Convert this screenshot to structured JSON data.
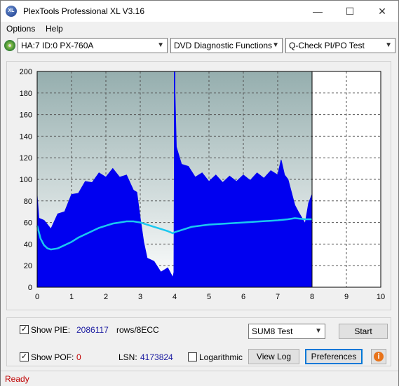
{
  "window": {
    "title": "PlexTools Professional XL V3.16",
    "icon_text": "XL",
    "controls": {
      "minimize": "—",
      "maximize": "☐",
      "close": "✕"
    }
  },
  "menu": {
    "items": [
      "Options",
      "Help"
    ]
  },
  "toolbar": {
    "drive": "HA:7 ID:0  PX-760A",
    "function": "DVD Diagnostic Functions",
    "test": "Q-Check PI/PO Test"
  },
  "chart_data": {
    "type": "area",
    "xlim": [
      0,
      10
    ],
    "ylim": [
      0,
      200
    ],
    "x_ticks": [
      "0",
      "1",
      "2",
      "3",
      "4",
      "5",
      "6",
      "7",
      "8",
      "9",
      "10"
    ],
    "y_ticks": [
      "0",
      "20",
      "40",
      "60",
      "80",
      "100",
      "120",
      "140",
      "160",
      "180",
      "200"
    ],
    "grid": true,
    "colors": {
      "plot_bg": "#95aeae",
      "pie": "#0000f0",
      "sum8": "#1ac8f0",
      "frame": "#000000"
    },
    "series": [
      {
        "name": "",
        "role": "pie_envelope",
        "x": [
          0,
          0.05,
          0.2,
          0.4,
          0.6,
          0.8,
          1.0,
          1.2,
          1.4,
          1.6,
          1.8,
          2.0,
          2.2,
          2.4,
          2.6,
          2.8,
          2.9,
          3.0,
          3.1,
          3.2,
          3.4,
          3.6,
          3.8,
          3.95,
          3.98,
          4.0,
          4.05,
          4.2,
          4.4,
          4.6,
          4.8,
          5.0,
          5.2,
          5.4,
          5.6,
          5.8,
          6.0,
          6.2,
          6.4,
          6.6,
          6.8,
          7.0,
          7.1,
          7.2,
          7.3,
          7.5,
          7.6,
          7.8,
          7.9,
          8.0
        ],
        "y": [
          85,
          70,
          62,
          60,
          68,
          76,
          86,
          93,
          98,
          103,
          106,
          108,
          110,
          108,
          104,
          96,
          88,
          70,
          42,
          33,
          24,
          20,
          18,
          15,
          14,
          200,
          130,
          120,
          112,
          108,
          106,
          104,
          104,
          103,
          103,
          104,
          104,
          105,
          106,
          107,
          108,
          110,
          118,
          110,
          100,
          82,
          70,
          65,
          78,
          92
        ]
      },
      {
        "name": "",
        "role": "sum8",
        "x": [
          0,
          0.1,
          0.2,
          0.3,
          0.4,
          0.6,
          0.8,
          1.0,
          1.2,
          1.4,
          1.6,
          1.8,
          2.0,
          2.2,
          2.4,
          2.6,
          2.8,
          3.0,
          3.2,
          3.4,
          3.6,
          3.8,
          3.95,
          4.0,
          4.2,
          4.5,
          5.0,
          5.5,
          6.0,
          6.5,
          7.0,
          7.3,
          7.5,
          7.8,
          8.0
        ],
        "y": [
          57,
          45,
          39,
          36,
          35,
          36,
          39,
          42,
          46,
          49,
          52,
          55,
          57,
          59,
          60,
          61,
          61,
          60,
          58,
          56,
          54,
          52,
          50,
          51,
          53,
          56,
          58,
          59,
          60,
          61,
          62,
          63,
          64,
          63,
          63
        ]
      }
    ]
  },
  "controls": {
    "show_pie_label": "Show PIE:",
    "pie_value": "2086117",
    "rows_label": "rows/8ECC",
    "show_pof_label": "Show POF:",
    "pof_value": "0",
    "lsn_label": "LSN:",
    "lsn_value": "4173824",
    "logarithmic_label": "Logarithmic",
    "sum_select": "SUM8 Test",
    "start_button": "Start",
    "view_log_button": "View Log",
    "preferences_button": "Preferences",
    "check_mark": "✓",
    "info_icon": "i"
  },
  "status": {
    "text": "Ready"
  }
}
